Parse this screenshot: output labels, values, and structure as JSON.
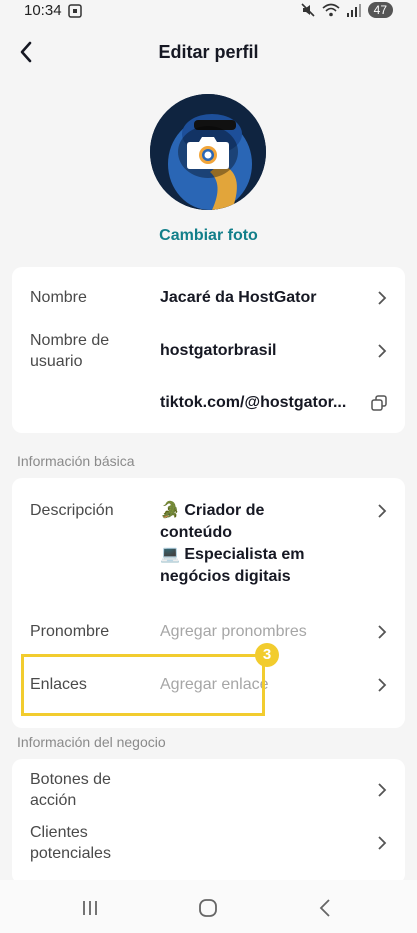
{
  "status_bar": {
    "time": "10:34",
    "battery": "47"
  },
  "header": {
    "title": "Editar perfil"
  },
  "profile": {
    "change_photo_label": "Cambiar foto"
  },
  "account": {
    "name_label": "Nombre",
    "name_value": "Jacaré da HostGator",
    "username_label": "Nombre de usuario",
    "username_value": "hostgatorbrasil",
    "profile_link": "tiktok.com/@hostgator..."
  },
  "basic_info": {
    "section_title": "Información básica",
    "description_label": "Descripción",
    "description_lines": [
      "🐊 Criador de",
      "conteúdo",
      "💻 Especialista em",
      "negócios digitais"
    ],
    "pronoun_label": "Pronombre",
    "pronoun_placeholder": "Agregar pronombres",
    "links_label": "Enlaces",
    "links_placeholder": "Agregar enlace"
  },
  "annotation": {
    "step_number": "3",
    "highlight_color": "#f2cc2e"
  },
  "business_info": {
    "section_title": "Información del negocio",
    "action_buttons_label": "Botones de acción",
    "leads_label": "Clientes potenciales"
  },
  "colors": {
    "accent": "#127f8a",
    "background": "#f5f5f5"
  }
}
